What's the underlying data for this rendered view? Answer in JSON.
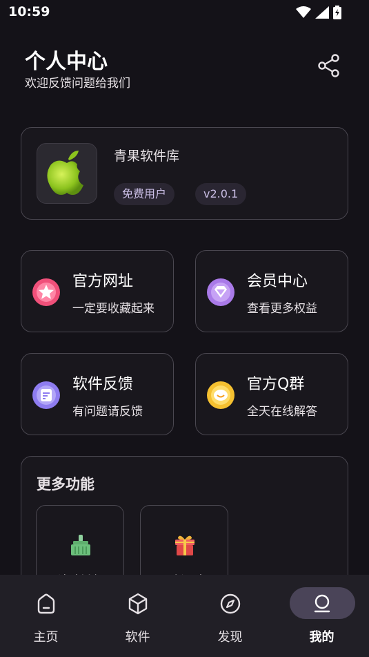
{
  "status_bar": {
    "time": "10:59",
    "icons": [
      "wifi-icon",
      "signal-icon",
      "battery-charging-icon"
    ]
  },
  "header": {
    "title": "个人中心",
    "subtitle": "欢迎反馈问题给我们",
    "share_icon": "share-icon"
  },
  "profile": {
    "app_name": "青果软件库",
    "user_type": "免费用户",
    "version": "v2.0.1",
    "logo_icon": "green-apple-logo"
  },
  "features": [
    {
      "title": "官方网址",
      "subtitle": "一定要收藏起来",
      "icon": "star-icon",
      "color": "#f0507a"
    },
    {
      "title": "会员中心",
      "subtitle": "查看更多权益",
      "icon": "diamond-icon",
      "color": "#a97ae8"
    },
    {
      "title": "软件反馈",
      "subtitle": "有问题请反馈",
      "icon": "feedback-icon",
      "color": "#8e7cf0"
    },
    {
      "title": "官方Q群",
      "subtitle": "全天在线解答",
      "icon": "chat-icon",
      "color": "#f5c030"
    }
  ],
  "more": {
    "title": "更多功能",
    "tools": [
      {
        "label": "清除缓存",
        "icon": "broom-icon"
      },
      {
        "label": "更新日志",
        "icon": "gift-icon"
      }
    ]
  },
  "nav": {
    "active": "我的",
    "items": [
      {
        "label": "主页",
        "icon": "home-icon"
      },
      {
        "label": "软件",
        "icon": "cube-icon"
      },
      {
        "label": "发现",
        "icon": "compass-icon"
      },
      {
        "label": "我的",
        "icon": "person-icon"
      }
    ]
  }
}
